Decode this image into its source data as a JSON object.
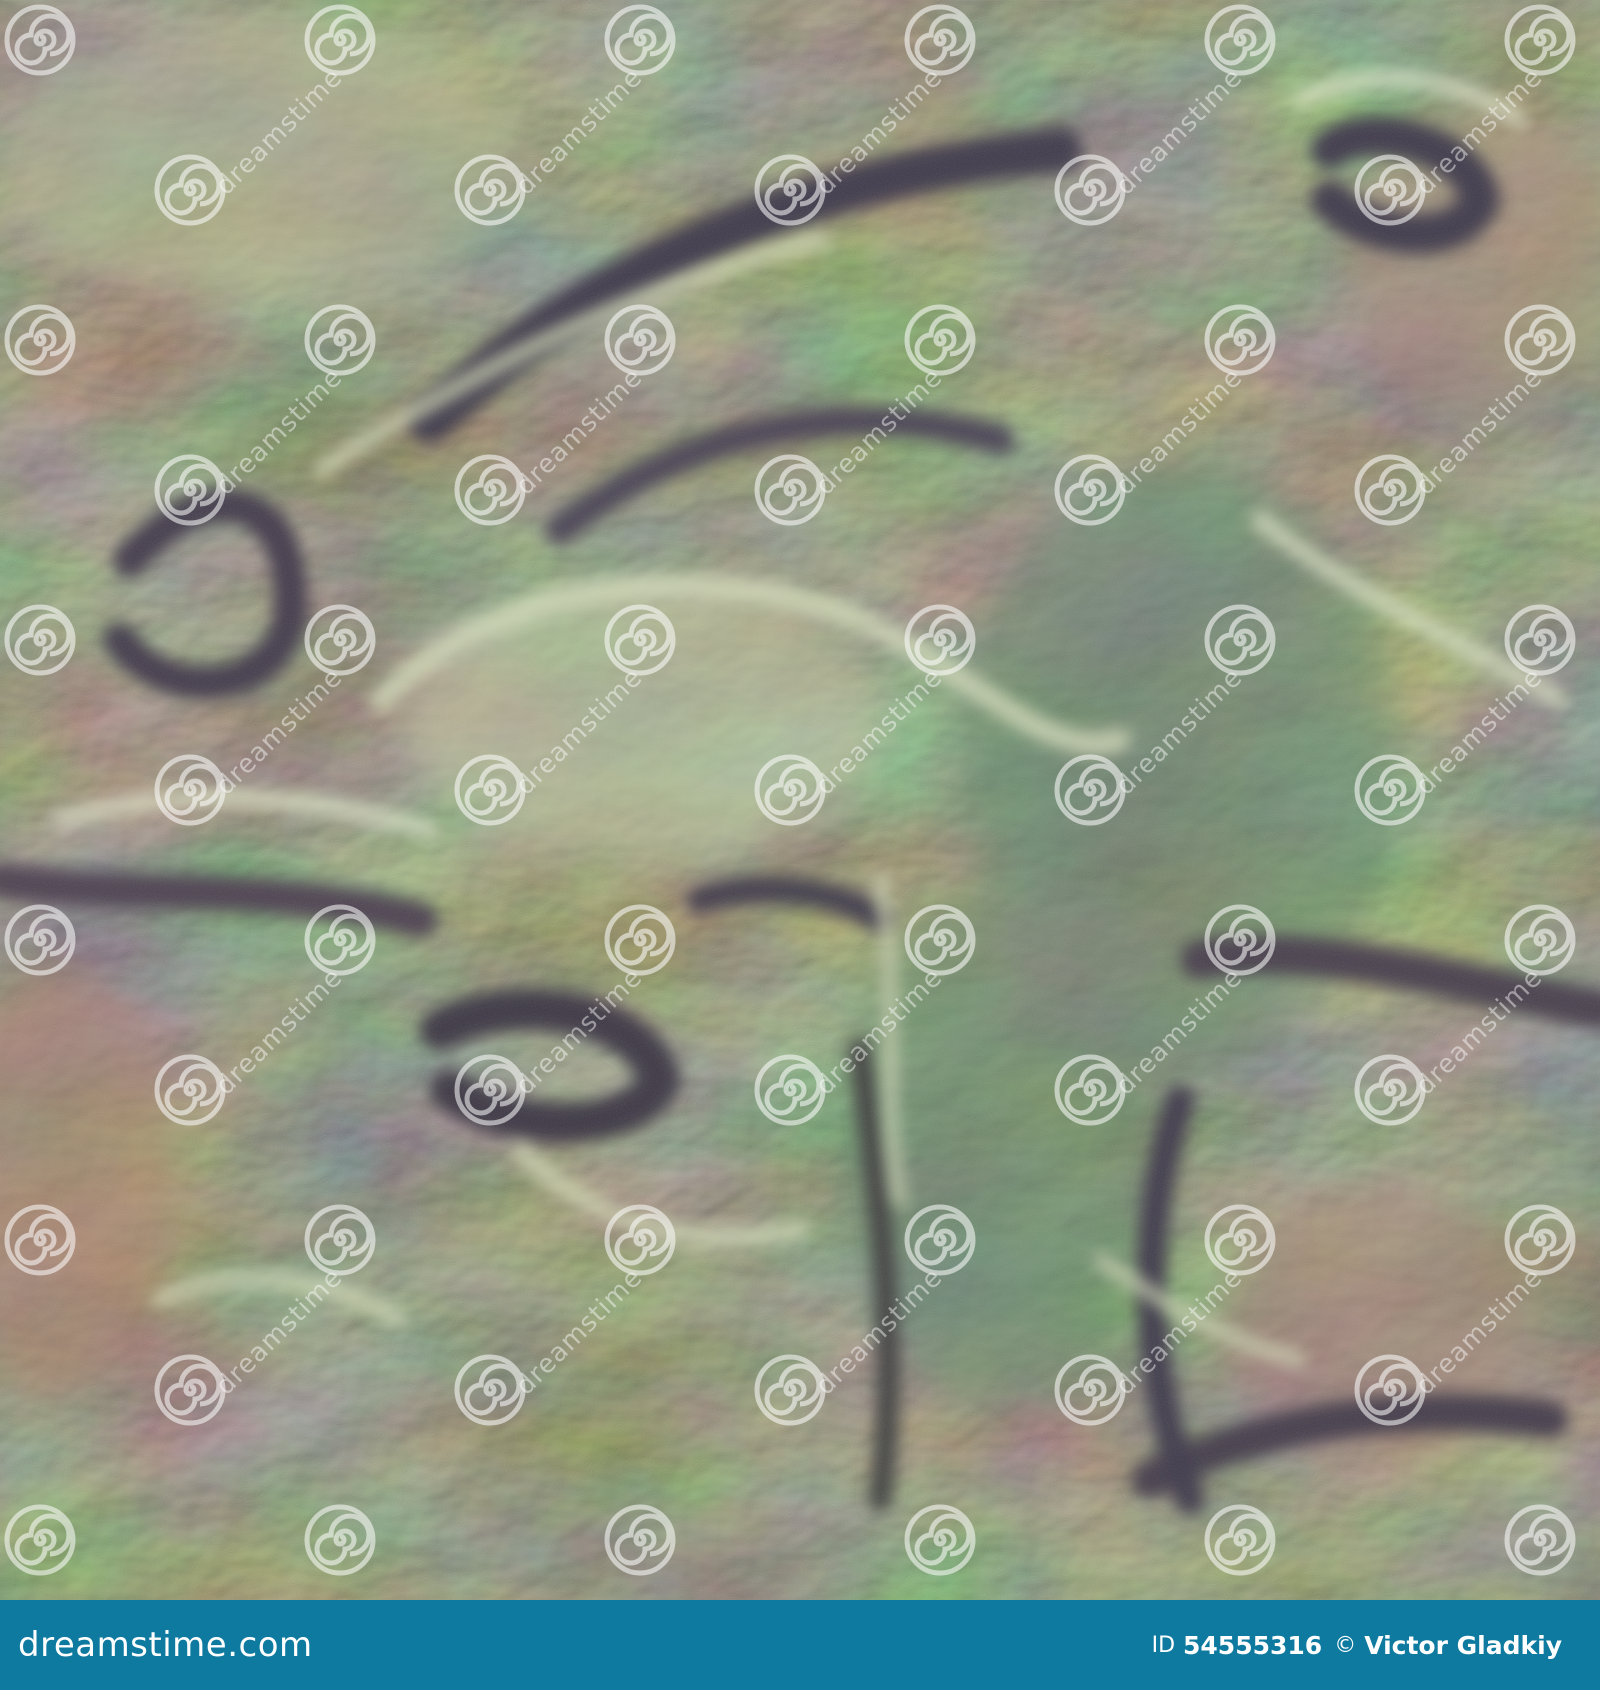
{
  "image": {
    "subject": "terrain-texture",
    "palette": {
      "base": "#8a8c78",
      "light": "#b9bf9e",
      "highlight": "#d6dcc0",
      "shadow": "#4a4452",
      "deep": "#3b3543",
      "green": "#6f8a72",
      "rust": "#9c7a6a",
      "pink": "#a07a78"
    }
  },
  "watermark": {
    "text": "dreamstime",
    "icon": "spiral-icon"
  },
  "footer": {
    "background": "#0e7aa0",
    "logo_text": "dreamstime.com",
    "id_label": "ID",
    "id_value": "54555316",
    "copyright": "©",
    "author": "Victor Gladkiy"
  }
}
